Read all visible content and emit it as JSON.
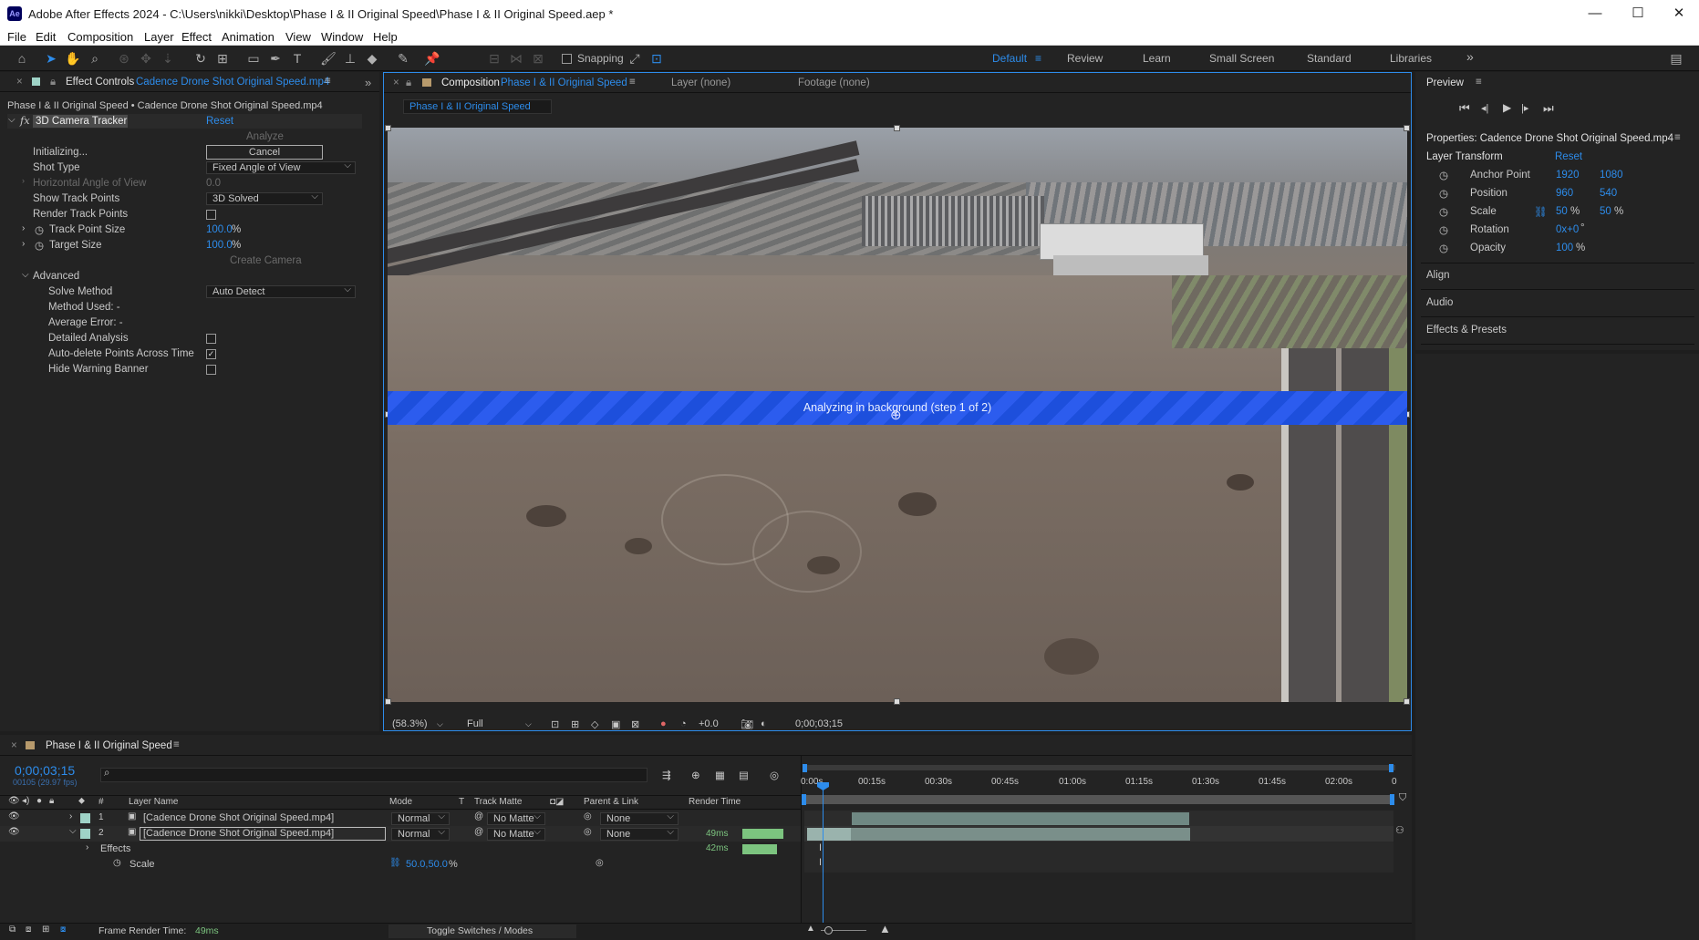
{
  "window": {
    "app_icon": "Ae",
    "title": "Adobe After Effects 2024 - C:\\Users\\nikki\\Desktop\\Phase I & II Original Speed\\Phase I & II Original Speed.aep *",
    "controls": [
      "—",
      "☐",
      "✕"
    ]
  },
  "menu": [
    "File",
    "Edit",
    "Composition",
    "Layer",
    "Effect",
    "Animation",
    "View",
    "Window",
    "Help"
  ],
  "toolbar": {
    "snapping": "Snapping",
    "workspaces": [
      "Default",
      "Review",
      "Learn",
      "Small Screen",
      "Standard",
      "Libraries"
    ],
    "active_workspace": "Default",
    "more": "»"
  },
  "effect_controls": {
    "tab_label": "Effect Controls",
    "tab_layer": "Cadence Drone Shot Original Speed.mp4",
    "breadcrumb": "Phase I & II Original Speed • Cadence Drone Shot Original Speed.mp4",
    "fx_badge": "fx",
    "effect_name": "3D Camera Tracker",
    "reset": "Reset",
    "analyze": "Analyze",
    "status": "Initializing...",
    "cancel": "Cancel",
    "shot_type_label": "Shot Type",
    "shot_type_value": "Fixed Angle of View",
    "hfov_label": "Horizontal Angle of View",
    "hfov_value": "0.0",
    "show_track_label": "Show Track Points",
    "show_track_value": "3D Solved",
    "render_track_label": "Render Track Points",
    "track_point_size_label": "Track Point Size",
    "track_point_size_value": "100.0",
    "target_size_label": "Target Size",
    "target_size_value": "100.0",
    "percent": "%",
    "create_camera": "Create Camera",
    "advanced_label": "Advanced",
    "solve_method_label": "Solve Method",
    "solve_method_value": "Auto Detect",
    "method_used": "Method Used: -",
    "average_error": "Average Error: -",
    "detailed_analysis": "Detailed Analysis",
    "auto_delete": "Auto-delete Points Across Time",
    "auto_delete_checked": true,
    "hide_warning": "Hide Warning Banner"
  },
  "composition": {
    "tab_label": "Composition",
    "tab_name": "Phase I & II Original Speed",
    "layer_tab": "Layer",
    "layer_tab_value": "(none)",
    "footage_tab": "Footage",
    "footage_tab_value": "(none)",
    "breadcrumb": "Phase I & II Original Speed",
    "banner": "Analyzing in background (step 1 of 2)",
    "zoom": "(58.3%)",
    "resolution": "Full",
    "exposure": "+0.0",
    "timecode": "0;00;03;15"
  },
  "preview": {
    "title": "Preview",
    "controls": [
      "⏮",
      "◂|",
      "▶",
      "|▸",
      "⏭"
    ]
  },
  "properties": {
    "title": "Properties: Cadence Drone Shot Original Speed.mp4",
    "section": "Layer Transform",
    "reset": "Reset",
    "rows": [
      {
        "label": "Anchor Point",
        "v1": "1920",
        "v2": "1080",
        "unit": ""
      },
      {
        "label": "Position",
        "v1": "960",
        "v2": "540",
        "unit": ""
      },
      {
        "label": "Scale",
        "v1": "50",
        "v2": "50",
        "unit": "%"
      },
      {
        "label": "Rotation",
        "v1": "0x+0",
        "v2": "",
        "unit": "°"
      },
      {
        "label": "Opacity",
        "v1": "100",
        "v2": "",
        "unit": "%"
      }
    ],
    "panels": [
      "Align",
      "Audio",
      "Effects & Presets"
    ]
  },
  "timeline": {
    "tab_name": "Phase I & II Original Speed",
    "timecode": "0;00;03;15",
    "frames": "00105 (29.97 fps)",
    "search_icon": "⌕",
    "columns": {
      "num": "#",
      "layer_name": "Layer Name",
      "mode": "Mode",
      "t": "T",
      "track_matte": "Track Matte",
      "parent": "Parent & Link",
      "render_time": "Render Time"
    },
    "ruler": [
      "0:00s",
      "00:15s",
      "00:30s",
      "00:45s",
      "01:00s",
      "01:15s",
      "01:30s",
      "01:45s",
      "02:00s",
      "0"
    ],
    "layers": [
      {
        "num": "1",
        "name": "[Cadence Drone Shot Original Speed.mp4]",
        "mode": "Normal",
        "matte": "No Matte",
        "parent": "None",
        "render": ""
      },
      {
        "num": "2",
        "name": "[Cadence Drone Shot Original Speed.mp4]",
        "mode": "Normal",
        "matte": "No Matte",
        "parent": "None",
        "render": "49ms"
      }
    ],
    "effects_label": "Effects",
    "effects_render": "42ms",
    "scale_label": "Scale",
    "scale_value": "50.0,50.0",
    "scale_unit": "%",
    "frame_render_label": "Frame Render Time:",
    "frame_render_value": "49ms",
    "toggle": "Toggle Switches / Modes"
  },
  "colors": {
    "accent": "#2d8ceb",
    "banner": "#1d4fdc",
    "render_bar": "#7cc47f",
    "layer_label": "#9fd3c7"
  }
}
